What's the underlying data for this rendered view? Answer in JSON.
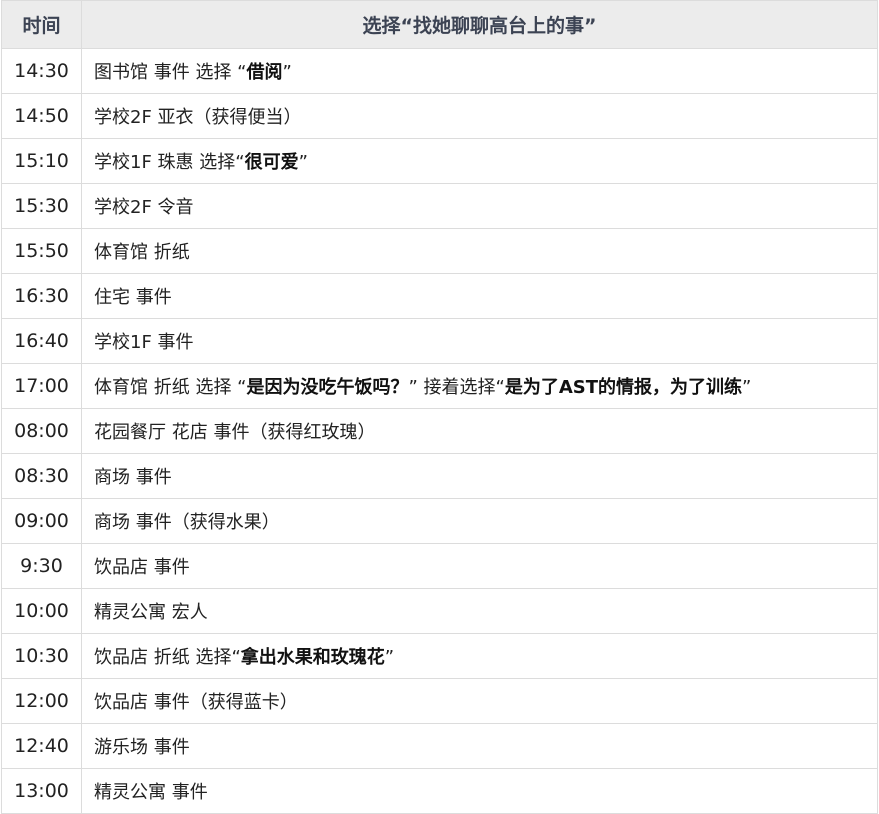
{
  "header": {
    "time": "时间",
    "choice": "选择“找她聊聊高台上的事”"
  },
  "rows": [
    {
      "time": "14:30",
      "parts": [
        {
          "t": "图书馆 事件 选择 “"
        },
        {
          "t": "借阅",
          "b": true
        },
        {
          "t": "”"
        }
      ]
    },
    {
      "time": "14:50",
      "parts": [
        {
          "t": "学校2F 亚衣（获得便当）"
        }
      ]
    },
    {
      "time": "15:10",
      "parts": [
        {
          "t": "学校1F 珠惠 选择“"
        },
        {
          "t": "很可爱",
          "b": true
        },
        {
          "t": "”"
        }
      ]
    },
    {
      "time": "15:30",
      "parts": [
        {
          "t": "学校2F 令音"
        }
      ]
    },
    {
      "time": "15:50",
      "parts": [
        {
          "t": "体育馆 折纸"
        }
      ]
    },
    {
      "time": "16:30",
      "parts": [
        {
          "t": "住宅 事件"
        }
      ]
    },
    {
      "time": "16:40",
      "parts": [
        {
          "t": "学校1F 事件"
        }
      ]
    },
    {
      "time": "17:00",
      "parts": [
        {
          "t": "体育馆 折纸 选择 “"
        },
        {
          "t": "是因为没吃午饭吗？",
          "b": true
        },
        {
          "t": "” 接着选择“"
        },
        {
          "t": "是为了AST的情报，为了训练",
          "b": true
        },
        {
          "t": "”"
        }
      ]
    },
    {
      "time": "08:00",
      "parts": [
        {
          "t": "花园餐厅 花店 事件（获得红玫瑰）"
        }
      ]
    },
    {
      "time": "08:30",
      "parts": [
        {
          "t": "商场 事件"
        }
      ]
    },
    {
      "time": "09:00",
      "parts": [
        {
          "t": "商场 事件（获得水果）"
        }
      ]
    },
    {
      "time": "9:30",
      "parts": [
        {
          "t": "饮品店 事件"
        }
      ]
    },
    {
      "time": "10:00",
      "parts": [
        {
          "t": "精灵公寓 宏人"
        }
      ]
    },
    {
      "time": "10:30",
      "parts": [
        {
          "t": "饮品店 折纸 选择“"
        },
        {
          "t": "拿出水果和玫瑰花",
          "b": true
        },
        {
          "t": "”"
        }
      ]
    },
    {
      "time": "12:00",
      "parts": [
        {
          "t": "饮品店 事件（获得蓝卡）"
        }
      ]
    },
    {
      "time": "12:40",
      "parts": [
        {
          "t": "游乐场 事件"
        }
      ]
    },
    {
      "time": "13:00",
      "parts": [
        {
          "t": "精灵公寓 事件"
        }
      ]
    }
  ]
}
